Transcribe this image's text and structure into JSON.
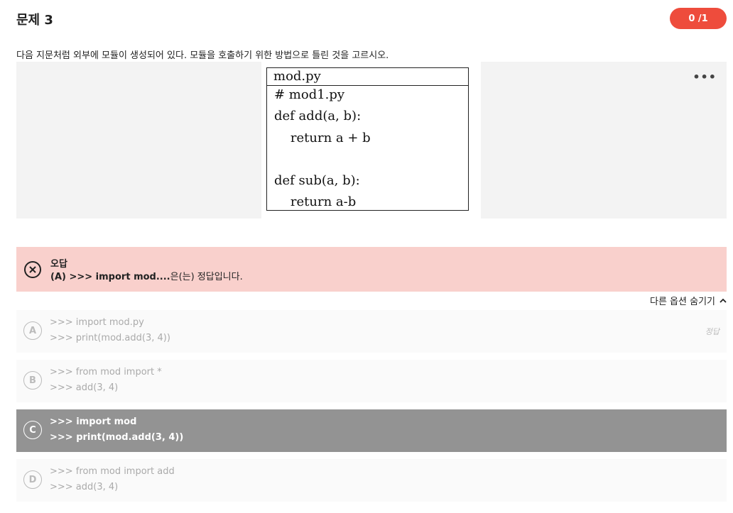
{
  "header": {
    "title": "문제 3",
    "score": "0 /1"
  },
  "question": "다음 지문처럼 외부에 모듈이 생성되어 있다. 모듈을 호출하기 위한 방법으로 틀린 것을 고르시오.",
  "code": {
    "filename": "mod.py",
    "lines": [
      "# mod1.py",
      "def add(a, b):",
      "    return a + b",
      "",
      "def sub(a, b):",
      "    return a-b"
    ]
  },
  "result": {
    "status": "오답",
    "answer_prefix": "(A) >>> import mod....",
    "answer_suffix": "은(는) 정답입니다."
  },
  "toggle_label": "다른 옵션 숨기기",
  "options": [
    {
      "letter": "A",
      "line1": ">>> import mod.py",
      "line2": ">>> print(mod.add(3, 4))",
      "tag": "정답"
    },
    {
      "letter": "B",
      "line1": ">>> from mod import *",
      "line2": ">>> add(3, 4)"
    },
    {
      "letter": "C",
      "line1": ">>> import mod",
      "line2": ">>> print(mod.add(3, 4))"
    },
    {
      "letter": "D",
      "line1": ">>> from mod import add",
      "line2": ">>> add(3, 4)"
    }
  ],
  "colors": {
    "accent": "#ee4c3c",
    "wrong_bg": "#f9d0cc",
    "selected_bg": "#939393"
  }
}
